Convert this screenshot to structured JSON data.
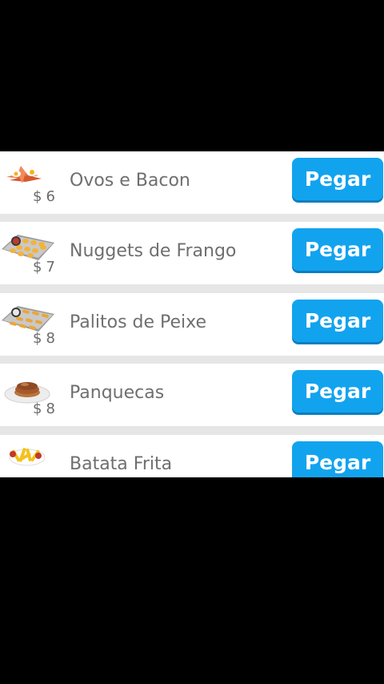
{
  "shop": {
    "items": [
      {
        "name": "Ovos e Bacon",
        "currency": "$",
        "price": "6",
        "button_label": "Pegar",
        "icon": "eggs-bacon-icon"
      },
      {
        "name": "Nuggets de Frango",
        "currency": "$",
        "price": "7",
        "button_label": "Pegar",
        "icon": "chicken-nuggets-tray-icon"
      },
      {
        "name": "Palitos de Peixe",
        "currency": "$",
        "price": "8",
        "button_label": "Pegar",
        "icon": "fish-sticks-tray-icon"
      },
      {
        "name": "Panquecas",
        "currency": "$",
        "price": "8",
        "button_label": "Pegar",
        "icon": "pancakes-icon"
      },
      {
        "name": "Batata Frita",
        "currency": "$",
        "price": "",
        "button_label": "Pegar",
        "icon": "french-fries-icon"
      }
    ]
  },
  "colors": {
    "button": "#12a3ef",
    "row_background": "#ffffff",
    "separator": "#e6e6e6",
    "text": "#6f6f6f"
  }
}
